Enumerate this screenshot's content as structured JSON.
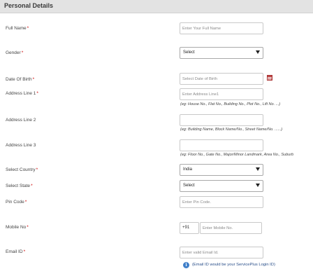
{
  "section": {
    "title": "Personal Details"
  },
  "fields": {
    "full_name": {
      "label": "Full Name",
      "required": "*",
      "placeholder": "Enter Your Full Name"
    },
    "gender": {
      "label": "Gender",
      "required": "*",
      "value": "Select"
    },
    "dob": {
      "label": "Date Of Birth",
      "required": "*",
      "placeholder": "Select Date of Birth"
    },
    "address1": {
      "label": "Address Line 1",
      "required": "*",
      "placeholder": "Enter Address Line1",
      "hint": "(eg: House No., Flat No., Building No., Plot No., Lift No. ...)"
    },
    "address2": {
      "label": "Address Line 2",
      "hint": "(eg: Building Name, Block Name/No., Street Name/No. ......)"
    },
    "address3": {
      "label": "Address Line 3",
      "hint": "(eg: Floor No., Gate No., Major/Minor Landmark, Area No., Suburb"
    },
    "country": {
      "label": "Select Country",
      "required": "*",
      "value": "India"
    },
    "state": {
      "label": "Select State",
      "required": "*",
      "value": "Select"
    },
    "pin": {
      "label": "Pin Code",
      "required": "*",
      "placeholder": "Enter Pin Code."
    },
    "mobile": {
      "label": "Mobile No",
      "required": "*",
      "prefix": "+91",
      "placeholder": "Enter Mobile No."
    },
    "email": {
      "label": "Email ID",
      "required": "*",
      "placeholder": "Enter valid Email Id.",
      "info": "(Email ID would be your ServicePlus Login ID)"
    }
  },
  "icons": {
    "calendar": "calendar-icon",
    "info": "info-icon",
    "info_glyph": "i"
  },
  "colors": {
    "header_bg": "#e3e3e3",
    "required": "#cc0000",
    "info_blue": "#3f7fc9"
  }
}
